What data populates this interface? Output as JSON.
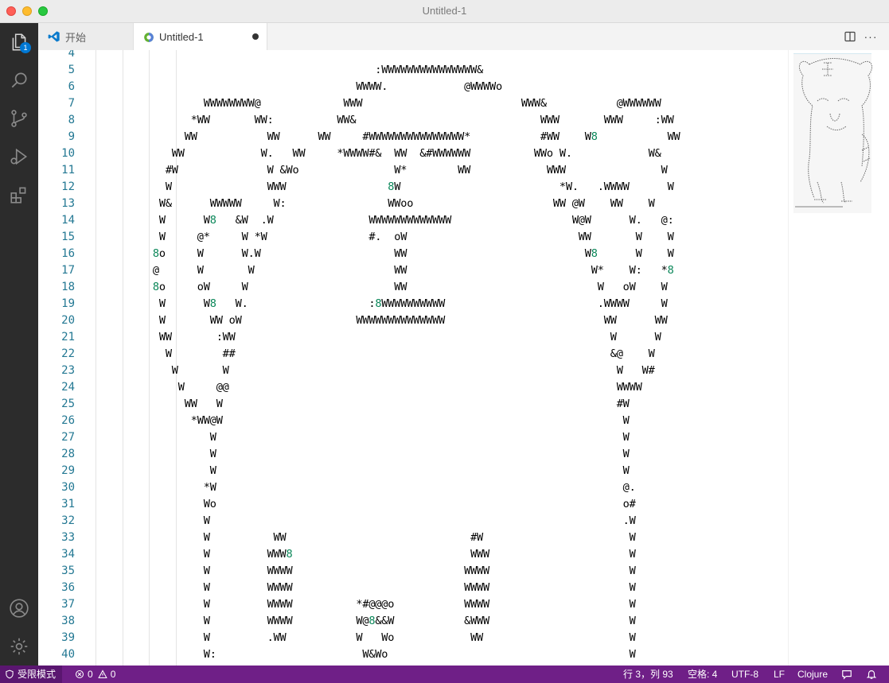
{
  "window": {
    "title": "Untitled-1"
  },
  "activity_bar": {
    "explorer_badge": "1"
  },
  "tabs": [
    {
      "label": "开始",
      "active": false,
      "modified": false
    },
    {
      "label": "Untitled-1",
      "active": true,
      "modified": true
    }
  ],
  "editor": {
    "lines": [
      {
        "n": "4",
        "t": ""
      },
      {
        "n": "5",
        "t": "                                            :WWWWWWWWWWWWWWW&"
      },
      {
        "n": "6",
        "t": "                                         WWWW.            @WWWWo"
      },
      {
        "n": "7",
        "t": "                 WWWWWWWW@             WWW                         WWW&           @WWWWWW"
      },
      {
        "n": "8",
        "t": "               *WW       WW:          WW&                             WWW       WWW     :WW"
      },
      {
        "n": "9",
        "t": "              WW           WW      WW     #WWWWWWWWWWWWWWW*           #WW    W8           WW"
      },
      {
        "n": "10",
        "t": "            WW            W.   WW     *WWWW#&  WW  &#WWWWWW          WWo W.            W&"
      },
      {
        "n": "11",
        "t": "           #W              W &Wo               W*        WW            WWW               W"
      },
      {
        "n": "12",
        "t": "           W               WWW                8W                         *W.   .WWWW      W"
      },
      {
        "n": "13",
        "t": "          W&      WWWWW     W:                WWoo                      WW @W    WW    W"
      },
      {
        "n": "14",
        "t": "          W      W8   &W  .W               WWWWWWWWWWWWW                   W@W      W.   @:"
      },
      {
        "n": "15",
        "t": "          W     @*     W *W                #.  oW                           WW       W    W"
      },
      {
        "n": "16",
        "t": "         8o     W      W.W                     WW                            W8      W    W"
      },
      {
        "n": "17",
        "t": "         @      W       W                      WW                             W*    W:   *8"
      },
      {
        "n": "18",
        "t": "         8o     oW     W                       WW                              W   oW    W"
      },
      {
        "n": "19",
        "t": "          W      W8   W.                   :8WWWWWWWWWW                        .WWWW     W"
      },
      {
        "n": "20",
        "t": "          W       WW oW                  WWWWWWWWWWWWWW                         WW      WW"
      },
      {
        "n": "21",
        "t": "          WW       :WW                                                           W      W"
      },
      {
        "n": "22",
        "t": "           W        ##                                                           &@    W"
      },
      {
        "n": "23",
        "t": "            W       W                                                             W   W#"
      },
      {
        "n": "24",
        "t": "             W     @@                                                             WWWW"
      },
      {
        "n": "25",
        "t": "              WW   W                                                              #W"
      },
      {
        "n": "26",
        "t": "               *WW@W                                                               W"
      },
      {
        "n": "27",
        "t": "                  W                                                                W"
      },
      {
        "n": "28",
        "t": "                  W                                                                W"
      },
      {
        "n": "29",
        "t": "                  W                                                                W"
      },
      {
        "n": "30",
        "t": "                 *W                                                                @."
      },
      {
        "n": "31",
        "t": "                 Wo                                                                o#"
      },
      {
        "n": "32",
        "t": "                 W                                                                 .W"
      },
      {
        "n": "33",
        "t": "                 W          WW                             #W                       W"
      },
      {
        "n": "34",
        "t": "                 W         WWW8                            WWW                      W"
      },
      {
        "n": "35",
        "t": "                 W         WWWW                           WWWW                      W"
      },
      {
        "n": "36",
        "t": "                 W         WWWW                           WWWW                      W"
      },
      {
        "n": "37",
        "t": "                 W         WWWW          *#@@@o           WWWW                      W"
      },
      {
        "n": "38",
        "t": "                 W         WWWW          W@8&&W           &WWW                      W"
      },
      {
        "n": "39",
        "t": "                 W         .WW           W   Wo            WW                       W"
      },
      {
        "n": "40",
        "t": "                 W:                       W&Wo                                      W"
      }
    ]
  },
  "status_bar": {
    "restricted_mode": "受限模式",
    "errors": "0",
    "warnings": "0",
    "cursor": "行 3，列 93",
    "indent": "空格: 4",
    "encoding": "UTF-8",
    "eol": "LF",
    "language": "Clojure"
  },
  "colors": {
    "status_bg": "#6f1f87",
    "activity_bg": "#2c2c2c",
    "line_number": "#237893",
    "accent": "#0078d4"
  }
}
